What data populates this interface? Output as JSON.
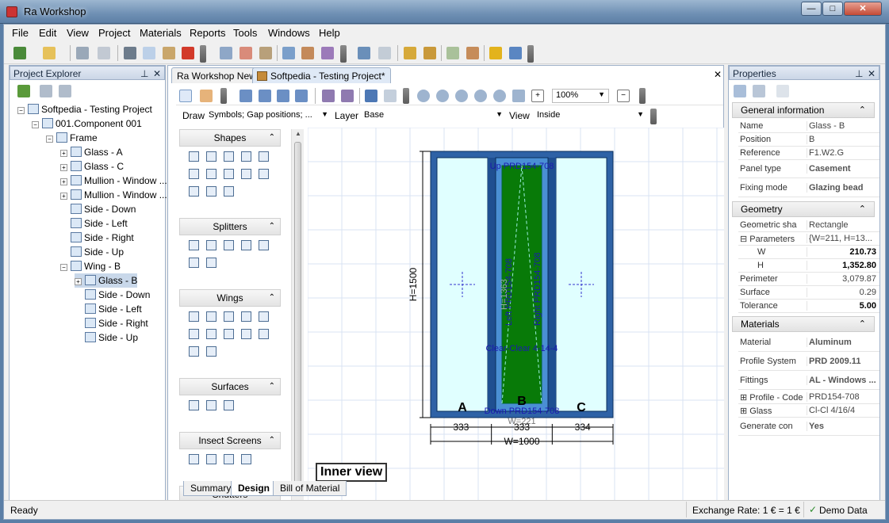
{
  "window": {
    "title": "Ra Workshop",
    "min": "—",
    "max": "□",
    "close": "✕"
  },
  "menu": [
    "File",
    "Edit",
    "View",
    "Project",
    "Materials",
    "Reports",
    "Tools",
    "Windows",
    "Help"
  ],
  "explorer": {
    "title": "Project Explorer",
    "pin": "⊥",
    "close": "✕",
    "tree": [
      {
        "label": "Softpedia - Testing Project",
        "level": 0,
        "exp": "−"
      },
      {
        "label": "001.Component 001",
        "level": 1,
        "exp": "−"
      },
      {
        "label": "Frame",
        "level": 2,
        "exp": "−"
      },
      {
        "label": "Glass - A",
        "level": 3,
        "exp": "+"
      },
      {
        "label": "Glass - C",
        "level": 3,
        "exp": "+"
      },
      {
        "label": "Mullion - Window ...",
        "level": 3,
        "exp": "+"
      },
      {
        "label": "Mullion - Window ...",
        "level": 3,
        "exp": "+"
      },
      {
        "label": "Side - Down",
        "level": 3,
        "exp": ""
      },
      {
        "label": "Side - Left",
        "level": 3,
        "exp": ""
      },
      {
        "label": "Side - Right",
        "level": 3,
        "exp": ""
      },
      {
        "label": "Side - Up",
        "level": 3,
        "exp": ""
      },
      {
        "label": "Wing - B",
        "level": 3,
        "exp": "−"
      },
      {
        "label": "Glass - B",
        "level": 4,
        "exp": "+"
      },
      {
        "label": "Side - Down",
        "level": 4,
        "exp": ""
      },
      {
        "label": "Side - Left",
        "level": 4,
        "exp": ""
      },
      {
        "label": "Side - Right",
        "level": 4,
        "exp": ""
      },
      {
        "label": "Side - Up",
        "level": 4,
        "exp": ""
      }
    ]
  },
  "doc": {
    "tabs": [
      "Ra Workshop News",
      "Softpedia - Testing Project*"
    ],
    "close": "✕",
    "zoom": "100%",
    "draw_label": "Draw",
    "draw_value": "Symbols; Gap positions; ...",
    "layer_label": "Layer",
    "layer_value": "Base",
    "view_label": "View",
    "view_value": "Inside",
    "palette": [
      {
        "name": "Shapes",
        "icons": 13
      },
      {
        "name": "Splitters",
        "icons": 7
      },
      {
        "name": "Wings",
        "icons": 12
      },
      {
        "name": "Surfaces",
        "icons": 3
      },
      {
        "name": "Insect Screens",
        "icons": 4
      },
      {
        "name": "Shutters",
        "icons": 4
      }
    ],
    "inner_view": "Inner view",
    "bottom_tabs": [
      "Summary",
      "Design",
      "Bill of Material"
    ]
  },
  "drawing": {
    "label_up": "Up PRD154-708",
    "label_down": "Down PRD154-708",
    "label_left": "Left PRD154-708",
    "label_right": "Right PRD154-708",
    "label_h1363": "H=1363",
    "label_clear": "Clear-Clear 4-14-4",
    "label_w221": "W=221",
    "height": "H=1500",
    "widths": [
      "333",
      "333",
      "334"
    ],
    "total_width": "W=1000",
    "panels": [
      "A",
      "B",
      "C"
    ],
    "colors": {
      "frame": "#2e62a6",
      "glass": "#e0ffff",
      "wing_glass": "#087a08",
      "grid": "#d9e3f3",
      "dim": "#000000"
    }
  },
  "properties": {
    "title": "Properties",
    "pin": "⊥",
    "close": "✕",
    "groups": [
      {
        "title": "General information",
        "rows": [
          {
            "k": "Name",
            "v": "Glass - B"
          },
          {
            "k": "Position",
            "v": "B"
          },
          {
            "k": "Reference",
            "v": "F1.W2.G"
          },
          {
            "k": "Panel type",
            "v": "Casement",
            "bold": true,
            "tall": true
          },
          {
            "k": "Fixing mode",
            "v": "Glazing bead",
            "bold": true,
            "tall": true
          }
        ]
      },
      {
        "title": "Geometry",
        "rows": [
          {
            "k": "Geometric sha",
            "v": "Rectangle"
          },
          {
            "k": "⊟ Parameters",
            "v": "{W=211, H=13..."
          },
          {
            "k": "W",
            "v": "210.73",
            "bold": true,
            "indent": true
          },
          {
            "k": "H",
            "v": "1,352.80",
            "bold": true,
            "indent": true
          },
          {
            "k": "Perimeter",
            "v": "3,079.87",
            "num": true
          },
          {
            "k": "Surface",
            "v": "0.29",
            "num": true
          },
          {
            "k": "Tolerance",
            "v": "5.00",
            "bold": true,
            "num": true
          }
        ]
      },
      {
        "title": "Materials",
        "rows": [
          {
            "k": "Material",
            "v": "Aluminum",
            "bold": true,
            "tall": true
          },
          {
            "k": "Profile System",
            "v": "PRD 2009.11",
            "bold": true,
            "tall": true
          },
          {
            "k": "Fittings",
            "v": "AL - Windows ...",
            "bold": true,
            "tall": true
          },
          {
            "k": "⊞ Profile - Code",
            "v": "PRD154-708"
          },
          {
            "k": "⊞ Glass",
            "v": "Cl-Cl 4/16/4"
          },
          {
            "k": "Generate con",
            "v": "Yes",
            "bold": true,
            "tall": true
          }
        ]
      }
    ]
  },
  "status": {
    "left": "Ready",
    "rate": "Exchange Rate: 1 € = 1 €",
    "demo": "Demo Data"
  }
}
